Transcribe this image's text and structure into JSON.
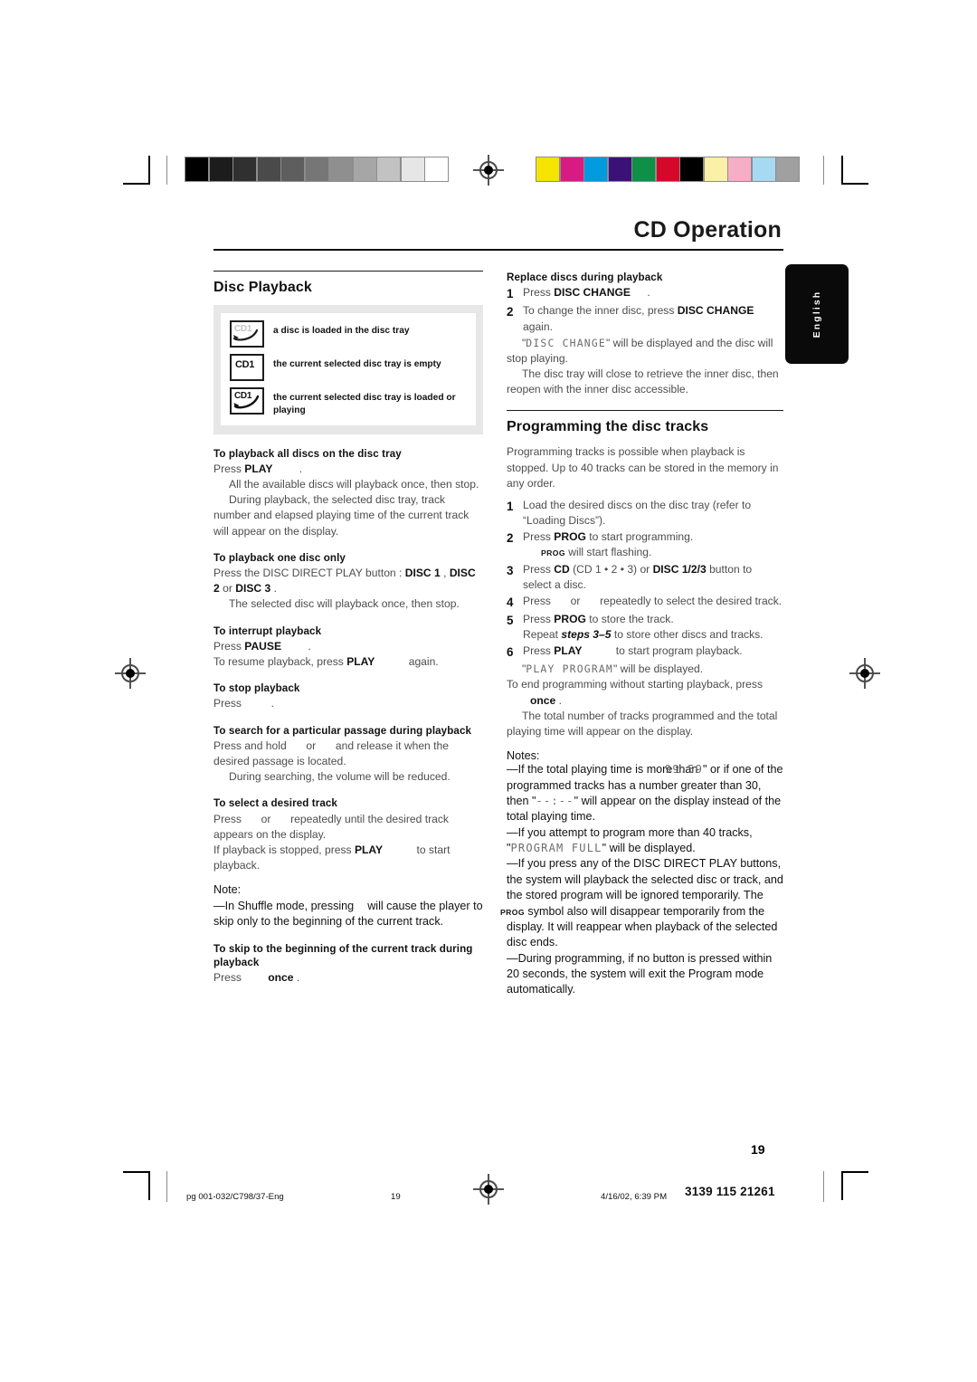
{
  "document": {
    "header_title": "CD Operation",
    "page_number": "19",
    "side_tab": "English"
  },
  "calibration": {
    "grayscale_label": "grayscale-calibration-bar",
    "grayscale_patches": [
      "#000000",
      "#1c1c1c",
      "#303030",
      "#4a4a4a",
      "#5e5e5e",
      "#767676",
      "#8f8f8f",
      "#a6a6a6",
      "#c2c2c2",
      "#e6e6e6",
      "#ffffff"
    ],
    "color_label": "color-calibration-bar",
    "color_patches": [
      "#f5e400",
      "#d81b82",
      "#009ade",
      "#3b1178",
      "#0e9048",
      "#d6082a",
      "#000000",
      "#faf0a8",
      "#f5aec6",
      "#a6d9f2",
      "#a0a0a0"
    ]
  },
  "left_column": {
    "section_title": "Disc Playback",
    "legend": [
      {
        "icon": "disc-loaded-icon",
        "cd_label": "CD1",
        "style": "faded-arrow",
        "text": "a disc is loaded in the disc tray"
      },
      {
        "icon": "disc-tray-empty-icon",
        "cd_label": "CD1",
        "style": "plain",
        "text": "the current selected disc tray is empty"
      },
      {
        "icon": "disc-tray-loaded-playing-icon",
        "cd_label": "CD1",
        "style": "solid-arrow",
        "text": "the current selected disc tray is loaded or playing"
      }
    ],
    "blocks": [
      {
        "heading": "To playback all discs on the disc tray",
        "lines": [
          {
            "type": "normal",
            "pre": "Press ",
            "bold": "PLAY",
            "post": " ."
          },
          {
            "type": "indent",
            "text": "All the available discs will playback once, then stop."
          },
          {
            "type": "indent",
            "text": "During playback, the selected disc tray, track number and elapsed playing time of the current track will appear on the display."
          }
        ]
      },
      {
        "heading": "To playback one disc only",
        "lines": [
          {
            "type": "normal",
            "pre": "Press the DISC DIRECT PLAY button : ",
            "bold": "DISC 1",
            "mid": " , ",
            "bold2": "DISC 2",
            "mid2": "  or ",
            "bold3": "DISC 3",
            "post": " ."
          },
          {
            "type": "indent",
            "text": "The selected disc will playback once, then stop."
          }
        ]
      },
      {
        "heading": "To interrupt playback",
        "lines": [
          {
            "type": "normal",
            "pre": "Press ",
            "bold": "PAUSE",
            "post": " ."
          },
          {
            "type": "normal",
            "pre": "To resume playback, press ",
            "bold": "PLAY",
            "post": "  again."
          }
        ]
      },
      {
        "heading": "To stop playback",
        "lines": [
          {
            "type": "normal",
            "pre": "Press ",
            "bold": "",
            "post": " ."
          }
        ]
      },
      {
        "heading": "To search for a particular passage during playback",
        "lines": [
          {
            "type": "normal",
            "pre": "Press and hold ",
            "bold": "",
            "mid": " or ",
            "post": " and release it when the desired passage is located."
          },
          {
            "type": "indent",
            "text": "During searching, the volume will be reduced."
          }
        ]
      },
      {
        "heading": "To select a desired track",
        "lines": [
          {
            "type": "normal",
            "pre": "Press ",
            "mid": " or ",
            "post": " repeatedly until the desired track appears on the display."
          },
          {
            "type": "normal",
            "pre": "If playback is stopped, press ",
            "bold": "PLAY",
            "post": "  to start playback."
          }
        ]
      }
    ],
    "note": {
      "title": "Note:",
      "text_pre": "—In Shuffle mode, pressing",
      "text_post": "will cause the player to skip only to the beginning of the current track."
    },
    "last_block": {
      "heading": "To skip to the beginning of the current track during playback",
      "line_pre": "Press ",
      "line_bold": "once",
      "line_post": " ."
    }
  },
  "right_column": {
    "replace_heading": "Replace discs during playback",
    "replace_steps": [
      {
        "num": "1",
        "pre": "Press ",
        "bold": "DISC CHANGE",
        "post": "  ."
      },
      {
        "num": "2",
        "pre": "To change the inner disc, press ",
        "bold": "DISC CHANGE",
        "post": "  again."
      }
    ],
    "replace_body": [
      {
        "type": "lcd",
        "pre": "\"",
        "lcd": "DISC CHANGE",
        "post": "\" will be displayed and the disc will stop playing."
      },
      {
        "type": "indent",
        "text": "The disc tray will close to retrieve the inner disc, then reopen with the inner disc accessible."
      }
    ],
    "program_title": "Programming the disc tracks",
    "program_intro": "Programming tracks is possible when playback is stopped. Up to 40 tracks can be stored in the memory in any order.",
    "program_steps": [
      {
        "num": "1",
        "text": "Load the desired discs on the disc tray (refer to “Loading Discs”)."
      },
      {
        "num": "2",
        "pre": "Press ",
        "bold": "PROG",
        "post": "  to start programming.",
        "sub_sym": "PROG",
        "sub_text": " will start flashing."
      },
      {
        "num": "3",
        "pre": "Press ",
        "bold": "CD",
        "mid": "  (CD 1 • 2 • 3) or ",
        "bold2": "DISC 1/2/3",
        "post": "  button to select a disc."
      },
      {
        "num": "4",
        "pre": "Press ",
        "mid": " or ",
        "post": " repeatedly to select the desired track."
      },
      {
        "num": "5",
        "pre": "Press ",
        "bold": "PROG",
        "post": "  to store the track.",
        "sub_pre": "Repeat ",
        "sub_bold": "steps 3–5",
        "sub_post": " to store other discs and tracks."
      },
      {
        "num": "6",
        "pre": "Press ",
        "bold": "PLAY",
        "post": "  to start program playback."
      }
    ],
    "program_after": [
      {
        "type": "lcd-indent",
        "pre": "\"",
        "lcd": "PLAY PROGRAM",
        "post": "\" will be displayed."
      },
      {
        "type": "normal",
        "text": "To end programming without starting playback, press "
      },
      {
        "type": "bold-inline",
        "bold": "once",
        "post": " ."
      },
      {
        "type": "indent",
        "text": "The total number of tracks programmed and the total playing time will appear on the display."
      }
    ],
    "notes_title": "Notes:",
    "notes": [
      {
        "id": "note-playing-time",
        "pre": "—If the total playing time is more than ",
        "lcd": "99:59",
        "mid": "\" or if one of the programmed tracks has a number greater than 30, then \"",
        "lcd2": "--:--",
        "post": "\" will appear on the display instead of the total playing time."
      },
      {
        "id": "note-program-full",
        "pre": "—If you attempt to program more than 40 tracks, \"",
        "lcd": "PROGRAM FULL",
        "post": "\" will be displayed."
      },
      {
        "id": "note-disc-direct",
        "pre": "—If you press any of the DISC DIRECT PLAY buttons, the system will playback the selected disc or track, and the stored program will be ignored temporarily. The ",
        "sym": "PROG",
        "post": " symbol also will disappear temporarily from the display. It will reappear when playback of the selected disc ends."
      },
      {
        "id": "note-timeout",
        "pre": "—During programming, if no button is pressed within 20 seconds, the system will exit the Program mode automatically.",
        "post": ""
      }
    ]
  },
  "footer": {
    "file": "pg 001-032/C798/37-Eng",
    "page": "19",
    "date": "4/16/02, 6:39 PM",
    "code": "3139 115 21261"
  }
}
